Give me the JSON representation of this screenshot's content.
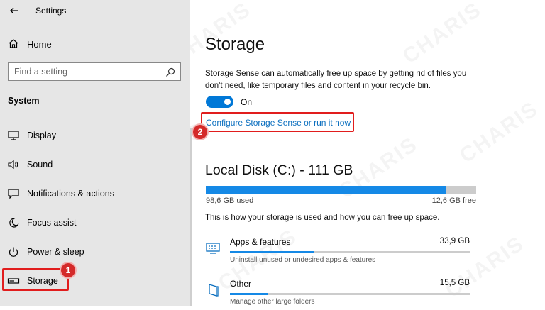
{
  "window": {
    "title": "Settings"
  },
  "sidebar": {
    "home_label": "Home",
    "search_placeholder": "Find a setting",
    "section_label": "System",
    "items": [
      {
        "label": "Display",
        "icon": "display-icon"
      },
      {
        "label": "Sound",
        "icon": "speaker-icon"
      },
      {
        "label": "Notifications & actions",
        "icon": "notification-icon"
      },
      {
        "label": "Focus assist",
        "icon": "moon-icon"
      },
      {
        "label": "Power & sleep",
        "icon": "power-icon"
      },
      {
        "label": "Storage",
        "icon": "storage-icon",
        "selected": true
      }
    ]
  },
  "callouts": {
    "storage": "1",
    "configure": "2"
  },
  "main": {
    "title": "Storage",
    "description": "Storage Sense can automatically free up space by getting rid of files you don't need, like temporary files and content in your recycle bin.",
    "toggle": {
      "state": "On",
      "on": true
    },
    "configure_link": "Configure Storage Sense or run it now",
    "disk": {
      "name": "Local Disk (C:) - 111 GB",
      "used_label": "98,6 GB used",
      "free_label": "12,6 GB free",
      "used_fraction": 0.887
    },
    "usage_intro": "This is how your storage is used and how you can free up space.",
    "categories": [
      {
        "name": "Apps & features",
        "size": "33,9 GB",
        "sub": "Uninstall unused or undesired apps & features",
        "fraction": 0.35,
        "icon": "apps-features-icon"
      },
      {
        "name": "Other",
        "size": "15,5 GB",
        "sub": "Manage other large folders",
        "fraction": 0.16,
        "icon": "folder-icon"
      }
    ]
  },
  "watermark": "CHARIS",
  "colors": {
    "accent": "#0078d7",
    "highlight": "#e11d1d",
    "sidebar_bg": "#e6e6e6"
  }
}
